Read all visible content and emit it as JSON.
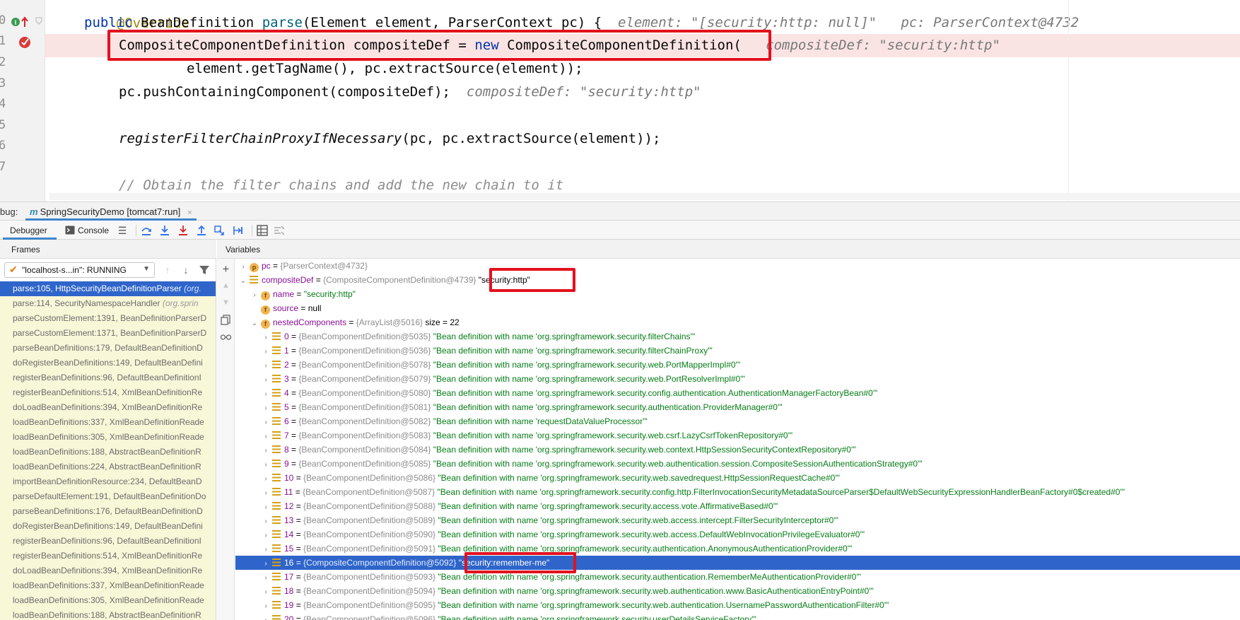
{
  "editor": {
    "line_numbers": [
      "0",
      "1",
      "2",
      "3",
      "4",
      "5",
      "6",
      "7"
    ],
    "line0": {
      "annotation": "@Override",
      "kw_public": "public",
      "type": "BeanDefinition",
      "method": "parse",
      "params": "(Element element, ParserContext pc) {",
      "hint": "element: \"[security:http: null]\"   pc: ParserContext@4732"
    },
    "line1": {
      "decl": "CompositeComponentDefinition compositeDef = ",
      "kw_new": "new",
      "ctor": " CompositeComponentDefinition(",
      "hint": "compositeDef: \"security:http\""
    },
    "line2": {
      "text": "element.getTagName(), pc.extractSource(element));"
    },
    "line3": {
      "text": "pc.pushContainingComponent(compositeDef);",
      "hint": "compositeDef: \"security:http\""
    },
    "line5": {
      "method": "registerFilterChainProxyIfNecessary",
      "args": "(pc, pc.extractSource(element));"
    },
    "line7": {
      "comment": "// Obtain the filter chains and add the new chain to it"
    }
  },
  "debug": {
    "title_label": "bug:",
    "run_config_icon": "m",
    "run_config": "SpringSecurityDemo [tomcat7:run]",
    "run_config_close": "×",
    "tabs": {
      "debugger": "Debugger",
      "console": "Console"
    },
    "frames_header": "Frames",
    "variables_header": "Variables",
    "thread": "\"localhost-s...in\": RUNNING",
    "frames": [
      {
        "text": "parse:105, HttpSecurityBeanDefinitionParser ",
        "pkg": "(org."
      },
      {
        "text": "parse:114, SecurityNamespaceHandler ",
        "pkg": "(org.sprin"
      },
      {
        "text": "parseCustomElement:1391, BeanDefinitionParserD",
        "pkg": ""
      },
      {
        "text": "parseCustomElement:1371, BeanDefinitionParserD",
        "pkg": ""
      },
      {
        "text": "parseBeanDefinitions:179, DefaultBeanDefinitionD",
        "pkg": ""
      },
      {
        "text": "doRegisterBeanDefinitions:149, DefaultBeanDefini",
        "pkg": ""
      },
      {
        "text": "registerBeanDefinitions:96, DefaultBeanDefinitionI",
        "pkg": ""
      },
      {
        "text": "registerBeanDefinitions:514, XmlBeanDefinitionRe",
        "pkg": ""
      },
      {
        "text": "doLoadBeanDefinitions:394, XmlBeanDefinitionRe",
        "pkg": ""
      },
      {
        "text": "loadBeanDefinitions:337, XmlBeanDefinitionReade",
        "pkg": ""
      },
      {
        "text": "loadBeanDefinitions:305, XmlBeanDefinitionReade",
        "pkg": ""
      },
      {
        "text": "loadBeanDefinitions:188, AbstractBeanDefinitionR",
        "pkg": ""
      },
      {
        "text": "loadBeanDefinitions:224, AbstractBeanDefinitionR",
        "pkg": ""
      },
      {
        "text": "importBeanDefinitionResource:234, DefaultBeanD",
        "pkg": ""
      },
      {
        "text": "parseDefaultElement:191, DefaultBeanDefinitionDo",
        "pkg": ""
      },
      {
        "text": "parseBeanDefinitions:176, DefaultBeanDefinitionD",
        "pkg": ""
      },
      {
        "text": "doRegisterBeanDefinitions:149, DefaultBeanDefini",
        "pkg": ""
      },
      {
        "text": "registerBeanDefinitions:96, DefaultBeanDefinitionI",
        "pkg": ""
      },
      {
        "text": "registerBeanDefinitions:514, XmlBeanDefinitionRe",
        "pkg": ""
      },
      {
        "text": "doLoadBeanDefinitions:394, XmlBeanDefinitionRe",
        "pkg": ""
      },
      {
        "text": "loadBeanDefinitions:337, XmlBeanDefinitionReade",
        "pkg": ""
      },
      {
        "text": "loadBeanDefinitions:305, XmlBeanDefinitionReade",
        "pkg": ""
      },
      {
        "text": "loadBeanDefinitions:188, AbstractBeanDefinitionR",
        "pkg": ""
      }
    ],
    "variables": {
      "pc": {
        "badge": "p",
        "name": "pc",
        "eq": " = ",
        "type": "{ParserContext@4732}"
      },
      "compositeDef": {
        "name": "compositeDef",
        "eq": " = ",
        "type": "{CompositeComponentDefinition@4739} ",
        "value": "\"security:http\""
      },
      "name": {
        "badge": "f",
        "name": "name",
        "eq": " = ",
        "value": "\"security:http\""
      },
      "source": {
        "badge": "f",
        "name": "source",
        "eq": " = ",
        "value": "null"
      },
      "nested": {
        "badge": "f",
        "name": "nestedComponents",
        "eq": " = ",
        "type": "{ArrayList@5016} ",
        "size": " size = 22"
      },
      "components": [
        {
          "index": "0",
          "eq": " = ",
          "type": "{BeanComponentDefinition@5035} ",
          "value": "\"Bean definition with name 'org.springframework.security.filterChains'\""
        },
        {
          "index": "1",
          "eq": " = ",
          "type": "{BeanComponentDefinition@5036} ",
          "value": "\"Bean definition with name 'org.springframework.security.filterChainProxy'\""
        },
        {
          "index": "2",
          "eq": " = ",
          "type": "{BeanComponentDefinition@5078} ",
          "value": "\"Bean definition with name 'org.springframework.security.web.PortMapperImpl#0'\""
        },
        {
          "index": "3",
          "eq": " = ",
          "type": "{BeanComponentDefinition@5079} ",
          "value": "\"Bean definition with name 'org.springframework.security.web.PortResolverImpl#0'\""
        },
        {
          "index": "4",
          "eq": " = ",
          "type": "{BeanComponentDefinition@5080} ",
          "value": "\"Bean definition with name 'org.springframework.security.config.authentication.AuthenticationManagerFactoryBean#0'\""
        },
        {
          "index": "5",
          "eq": " = ",
          "type": "{BeanComponentDefinition@5081} ",
          "value": "\"Bean definition with name 'org.springframework.security.authentication.ProviderManager#0'\""
        },
        {
          "index": "6",
          "eq": " = ",
          "type": "{BeanComponentDefinition@5082} ",
          "value": "\"Bean definition with name 'requestDataValueProcessor'\""
        },
        {
          "index": "7",
          "eq": " = ",
          "type": "{BeanComponentDefinition@5083} ",
          "value": "\"Bean definition with name 'org.springframework.security.web.csrf.LazyCsrfTokenRepository#0'\""
        },
        {
          "index": "8",
          "eq": " = ",
          "type": "{BeanComponentDefinition@5084} ",
          "value": "\"Bean definition with name 'org.springframework.security.web.context.HttpSessionSecurityContextRepository#0'\""
        },
        {
          "index": "9",
          "eq": " = ",
          "type": "{BeanComponentDefinition@5085} ",
          "value": "\"Bean definition with name 'org.springframework.security.web.authentication.session.CompositeSessionAuthenticationStrategy#0'\""
        },
        {
          "index": "10",
          "eq": " = ",
          "type": "{BeanComponentDefinition@5086} ",
          "value": "\"Bean definition with name 'org.springframework.security.web.savedrequest.HttpSessionRequestCache#0'\""
        },
        {
          "index": "11",
          "eq": " = ",
          "type": "{BeanComponentDefinition@5087} ",
          "value": "\"Bean definition with name 'org.springframework.security.config.http.FilterInvocationSecurityMetadataSourceParser$DefaultWebSecurityExpressionHandlerBeanFactory#0$created#0'\""
        },
        {
          "index": "12",
          "eq": " = ",
          "type": "{BeanComponentDefinition@5088} ",
          "value": "\"Bean definition with name 'org.springframework.security.access.vote.AffirmativeBased#0'\""
        },
        {
          "index": "13",
          "eq": " = ",
          "type": "{BeanComponentDefinition@5089} ",
          "value": "\"Bean definition with name 'org.springframework.security.web.access.intercept.FilterSecurityInterceptor#0'\""
        },
        {
          "index": "14",
          "eq": " = ",
          "type": "{BeanComponentDefinition@5090} ",
          "value": "\"Bean definition with name 'org.springframework.security.web.access.DefaultWebInvocationPrivilegeEvaluator#0'\""
        },
        {
          "index": "15",
          "eq": " = ",
          "type": "{BeanComponentDefinition@5091} ",
          "value": "\"Bean definition with name 'org.springframework.security.authentication.AnonymousAuthenticationProvider#0'\""
        },
        {
          "index": "16",
          "eq": " = ",
          "type": "{CompositeComponentDefinition@5092} ",
          "value": "\"security:remember-me\""
        },
        {
          "index": "17",
          "eq": " = ",
          "type": "{BeanComponentDefinition@5093} ",
          "value": "\"Bean definition with name 'org.springframework.security.authentication.RememberMeAuthenticationProvider#0'\""
        },
        {
          "index": "18",
          "eq": " = ",
          "type": "{BeanComponentDefinition@5094} ",
          "value": "\"Bean definition with name 'org.springframework.security.web.authentication.www.BasicAuthenticationEntryPoint#0'\""
        },
        {
          "index": "19",
          "eq": " = ",
          "type": "{BeanComponentDefinition@5095} ",
          "value": "\"Bean definition with name 'org.springframework.security.web.authentication.UsernamePasswordAuthenticationFilter#0'\""
        },
        {
          "index": "20",
          "eq": " = ",
          "type": "{BeanComponentDefinition@5096} ",
          "value": "\"Bean definition with name 'org.springframework.security.userDetailsServiceFactory'\""
        }
      ]
    }
  },
  "colors": {
    "highlight_box": "#e3101e",
    "selection": "#2f65ca",
    "breakpoint_line": "#fae3e3",
    "frame_bg": "#f8f7d8"
  }
}
